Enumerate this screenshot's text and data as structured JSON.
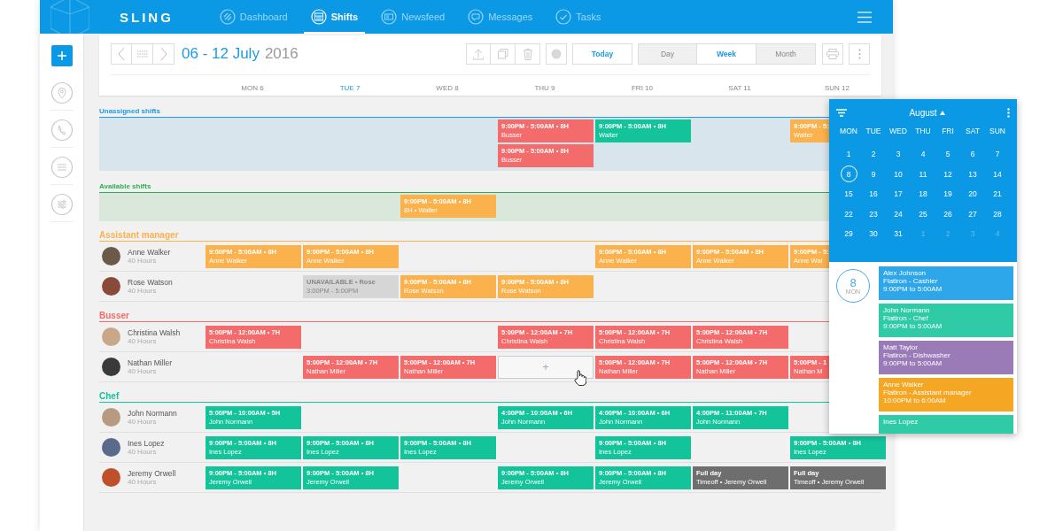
{
  "app": {
    "logo": "SLING"
  },
  "nav": [
    {
      "label": "Dashboard",
      "selected": false
    },
    {
      "label": "Shifts",
      "selected": true
    },
    {
      "label": "Newsfeed",
      "selected": false
    },
    {
      "label": "Messages",
      "selected": false
    },
    {
      "label": "Tasks",
      "selected": false
    }
  ],
  "toolbar": {
    "range": "06 - 12 July",
    "year": "2016",
    "today": "Today",
    "views": [
      {
        "label": "Day",
        "selected": false
      },
      {
        "label": "Week",
        "selected": true
      },
      {
        "label": "Month",
        "selected": false
      }
    ]
  },
  "days": [
    {
      "label": "MON 6",
      "selected": false
    },
    {
      "label": "TUE 7",
      "selected": true
    },
    {
      "label": "WED 8",
      "selected": false
    },
    {
      "label": "THU 9",
      "selected": false
    },
    {
      "label": "FRI 10",
      "selected": false
    },
    {
      "label": "SAT 11",
      "selected": false
    },
    {
      "label": "SUN 12",
      "selected": false
    }
  ],
  "bands": [
    {
      "title": "Unassigned shifts",
      "kind": "unassigned",
      "lanes": [
        [
          {
            "kind": "empty"
          },
          {
            "kind": "empty"
          },
          {
            "kind": "empty"
          },
          {
            "kind": "shift",
            "time": "9:00PM - 5:00AM • 8H",
            "label": "Busser",
            "color": "#f46b6b"
          },
          {
            "kind": "shift",
            "time": "9:00PM - 5:00AM • 8H",
            "label": "Waiter",
            "color": "#13c39a"
          },
          {
            "kind": "empty"
          },
          {
            "kind": "shift",
            "time": "9:00PM - 5:",
            "label": "Waiter",
            "color": "#fbb24c"
          }
        ],
        [
          {
            "kind": "empty"
          },
          {
            "kind": "empty"
          },
          {
            "kind": "empty"
          },
          {
            "kind": "shift",
            "time": "9:00PM - 5:00AM • 8H",
            "label": "Busser",
            "color": "#f46b6b"
          }
        ]
      ]
    },
    {
      "title": "Available shifts",
      "kind": "available",
      "lanes": [
        [
          {
            "kind": "empty"
          },
          {
            "kind": "empty"
          },
          {
            "kind": "shift",
            "time": "9:00PM - 5:00AM • 8H",
            "label": "8H • Waiter",
            "color": "#fbb24c"
          }
        ]
      ]
    }
  ],
  "groups": [
    {
      "title": "Assistant manager",
      "color": "#fbb24c",
      "rows": [
        {
          "name": "Anne Walker",
          "hours": "40 Hours",
          "cells": [
            {
              "kind": "shift",
              "time": "9:00PM - 5:00AM • 8H",
              "label": "Anne Walker"
            },
            {
              "kind": "shift",
              "time": "9:00PM - 5:00AM • 8H",
              "label": "Anne Walker"
            },
            {
              "kind": "empty"
            },
            {
              "kind": "empty"
            },
            {
              "kind": "shift",
              "time": "9:00PM - 5:00AM • 8H",
              "label": "Anne Walker"
            },
            {
              "kind": "shift",
              "time": "9:00PM - 5:00AM • 8H",
              "label": "Anne Walker"
            },
            {
              "kind": "shift",
              "time": "9:00PM - 5:",
              "label": "Anne Wal"
            }
          ]
        },
        {
          "name": "Rose Watson",
          "hours": "40 Hours",
          "cells": [
            {
              "kind": "empty"
            },
            {
              "kind": "unavailable",
              "time": "UNAVAILABLE • Rose",
              "label": "3:00PM - 5:00PM"
            },
            {
              "kind": "shift",
              "time": "9:00PM - 5:00AM • 8H",
              "label": "Rose Watson"
            },
            {
              "kind": "shift",
              "time": "9:00PM - 5:00AM • 8H",
              "label": "Rose Watson"
            }
          ]
        }
      ]
    },
    {
      "title": "Busser",
      "color": "#f46b6b",
      "rows": [
        {
          "name": "Christina Walsh",
          "hours": "40 Hours",
          "cells": [
            {
              "kind": "shift",
              "time": "5:00PM - 12:00AM • 7H",
              "label": "Christina Walsh"
            },
            {
              "kind": "empty"
            },
            {
              "kind": "empty"
            },
            {
              "kind": "shift",
              "time": "5:00PM - 12:00AM • 7H",
              "label": "Christina Walsh"
            },
            {
              "kind": "shift",
              "time": "5:00PM - 12:00AM • 7H",
              "label": "Christina Walsh"
            },
            {
              "kind": "shift",
              "time": "5:00PM - 12:00AM • 7H",
              "label": "Christina Walsh"
            }
          ]
        },
        {
          "name": "Nathan Miller",
          "hours": "40 Hours",
          "cells": [
            {
              "kind": "empty"
            },
            {
              "kind": "shift",
              "time": "5:00PM - 12:00AM • 7H",
              "label": "Nathan Miller"
            },
            {
              "kind": "shift",
              "time": "5:00PM - 12:00AM • 7H",
              "label": "Nathan Miller"
            },
            {
              "kind": "add",
              "label": "+"
            },
            {
              "kind": "shift",
              "time": "5:00PM - 12:00AM • 7H",
              "label": "Nathan Miller"
            },
            {
              "kind": "shift",
              "time": "5:00PM - 12:00AM • 7H",
              "label": "Nathan Miller"
            },
            {
              "kind": "shift",
              "time": "5:00PM - 1",
              "label": "Nathan M"
            }
          ]
        }
      ]
    },
    {
      "title": "Chef",
      "color": "#13c39a",
      "rows": [
        {
          "name": "John Normann",
          "hours": "40 Hours",
          "cells": [
            {
              "kind": "shift",
              "time": "5:00PM - 10:00AM • 5H",
              "label": "John Normann"
            },
            {
              "kind": "empty"
            },
            {
              "kind": "empty"
            },
            {
              "kind": "shift",
              "time": "4:00PM - 10:00AM • 6H",
              "label": "John Normann"
            },
            {
              "kind": "shift",
              "time": "4:00PM - 10:00AM • 6H",
              "label": "John Normann"
            },
            {
              "kind": "shift",
              "time": "4:00PM - 11:00AM • 7H",
              "label": "John Normann"
            }
          ]
        },
        {
          "name": "Ines Lopez",
          "hours": "40 Hours",
          "cells": [
            {
              "kind": "shift",
              "time": "9:00PM - 5:00AM • 8H",
              "label": "Ines Lopez"
            },
            {
              "kind": "shift",
              "time": "9:00PM - 5:00AM • 8H",
              "label": "Ines Lopez"
            },
            {
              "kind": "shift",
              "time": "9:00PM - 5:00AM • 8H",
              "label": "Ines Lopez"
            },
            {
              "kind": "empty"
            },
            {
              "kind": "shift",
              "time": "9:00PM - 5:00AM • 8H",
              "label": "Ines Lopez"
            },
            {
              "kind": "empty"
            },
            {
              "kind": "shift",
              "time": "9:00PM - 5:00AM • 8H",
              "label": "Ines Lopez"
            }
          ]
        },
        {
          "name": "Jeremy Orwell",
          "hours": "40 Hours",
          "cells": [
            {
              "kind": "shift",
              "time": "9:00PM - 5:00AM • 8H",
              "label": "Jeremy Orwell"
            },
            {
              "kind": "shift",
              "time": "9:00PM - 5:00AM • 8H",
              "label": "Jeremy Orwell"
            },
            {
              "kind": "empty"
            },
            {
              "kind": "shift",
              "time": "9:00PM - 5:00AM • 8H",
              "label": "Jeremy Orwell"
            },
            {
              "kind": "shift",
              "time": "9:00PM - 5:00AM • 8H",
              "label": "Jeremy Orwell"
            },
            {
              "kind": "timeoff",
              "time": "Full day",
              "label": "Timeoff • Jeremy Orwell"
            },
            {
              "kind": "timeoff",
              "time": "Full day",
              "label": "Timeoff • Jeremy Orwell"
            }
          ]
        }
      ]
    }
  ],
  "popup": {
    "month": "August",
    "weekdays": [
      "MON",
      "TUE",
      "WED",
      "THU",
      "FRI",
      "SAT",
      "SUN"
    ],
    "dates": [
      {
        "label": "1",
        "selected": false,
        "outside": false
      },
      {
        "label": "2",
        "selected": false,
        "outside": false
      },
      {
        "label": "3",
        "selected": false,
        "outside": false
      },
      {
        "label": "4",
        "selected": false,
        "outside": false
      },
      {
        "label": "5",
        "selected": false,
        "outside": false
      },
      {
        "label": "6",
        "selected": false,
        "outside": false
      },
      {
        "label": "7",
        "selected": false,
        "outside": false
      },
      {
        "label": "8",
        "selected": true,
        "outside": false
      },
      {
        "label": "9",
        "selected": false,
        "outside": false
      },
      {
        "label": "10",
        "selected": false,
        "outside": false
      },
      {
        "label": "11",
        "selected": false,
        "outside": false
      },
      {
        "label": "12",
        "selected": false,
        "outside": false
      },
      {
        "label": "13",
        "selected": false,
        "outside": false
      },
      {
        "label": "14",
        "selected": false,
        "outside": false
      },
      {
        "label": "15",
        "selected": false,
        "outside": false
      },
      {
        "label": "16",
        "selected": false,
        "outside": false
      },
      {
        "label": "17",
        "selected": false,
        "outside": false
      },
      {
        "label": "18",
        "selected": false,
        "outside": false
      },
      {
        "label": "19",
        "selected": false,
        "outside": false
      },
      {
        "label": "20",
        "selected": false,
        "outside": false
      },
      {
        "label": "21",
        "selected": false,
        "outside": false
      },
      {
        "label": "22",
        "selected": false,
        "outside": false
      },
      {
        "label": "23",
        "selected": false,
        "outside": false
      },
      {
        "label": "24",
        "selected": false,
        "outside": false
      },
      {
        "label": "25",
        "selected": false,
        "outside": false
      },
      {
        "label": "26",
        "selected": false,
        "outside": false
      },
      {
        "label": "27",
        "selected": false,
        "outside": false
      },
      {
        "label": "28",
        "selected": false,
        "outside": false
      },
      {
        "label": "29",
        "selected": false,
        "outside": false
      },
      {
        "label": "30",
        "selected": false,
        "outside": false
      },
      {
        "label": "31",
        "selected": false,
        "outside": false
      },
      {
        "label": "1",
        "selected": false,
        "outside": true
      },
      {
        "label": "2",
        "selected": false,
        "outside": true
      },
      {
        "label": "3",
        "selected": false,
        "outside": true
      },
      {
        "label": "4",
        "selected": false,
        "outside": true
      }
    ],
    "day": {
      "number": "8",
      "weekday": "MON"
    },
    "events": [
      {
        "color": "#2ea6ea",
        "lines": [
          "Alex Johnson",
          "Flatiron - Cashier",
          "9:00PM to 5:00AM"
        ]
      },
      {
        "color": "#2fcba6",
        "lines": [
          "John Normann",
          "Flatiron - Chef",
          "9:00PM to 5:00AM"
        ]
      },
      {
        "color": "#9a7bb8",
        "lines": [
          "Matt Taylor",
          "Flatiron - Dishwasher",
          "9:00PM to 5:00AM"
        ]
      },
      {
        "color": "#f5a623",
        "lines": [
          "Anne Walker",
          "Flatiron - Assistant manager",
          "10:00PM to 6:00AM"
        ]
      },
      {
        "color": "#2fcba6",
        "lines": [
          "Ines Lopez"
        ]
      }
    ]
  }
}
